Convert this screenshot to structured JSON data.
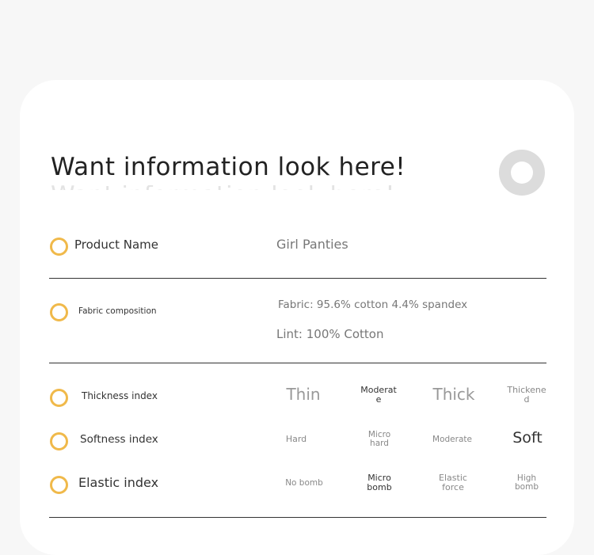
{
  "header": {
    "title": "Want information look here!"
  },
  "rows": {
    "product_name": {
      "label": "Product Name",
      "value": "Girl Panties"
    },
    "fabric": {
      "label": "Fabric composition",
      "value_1": "Fabric: 95.6% cotton 4.4% spandex",
      "value_2": "Lint: 100% Cotton"
    },
    "thickness": {
      "label": "Thickness index",
      "options": [
        "Thin",
        "Moderat e",
        "Thick",
        "Thickene d"
      ],
      "selected": "Moderat e"
    },
    "softness": {
      "label": "Softness index",
      "options": [
        "Hard",
        "Micro hard",
        "Moderate",
        "Soft"
      ],
      "selected": "Soft"
    },
    "elastic": {
      "label": "Elastic index",
      "options": [
        "No bomb",
        "Micro bomb",
        "Elastic force",
        "High bomb"
      ],
      "selected": "Micro bomb"
    }
  },
  "colors": {
    "accent": "#f0b94a",
    "ring": "#dcdcdc",
    "text": "#333333",
    "muted": "#777777"
  }
}
